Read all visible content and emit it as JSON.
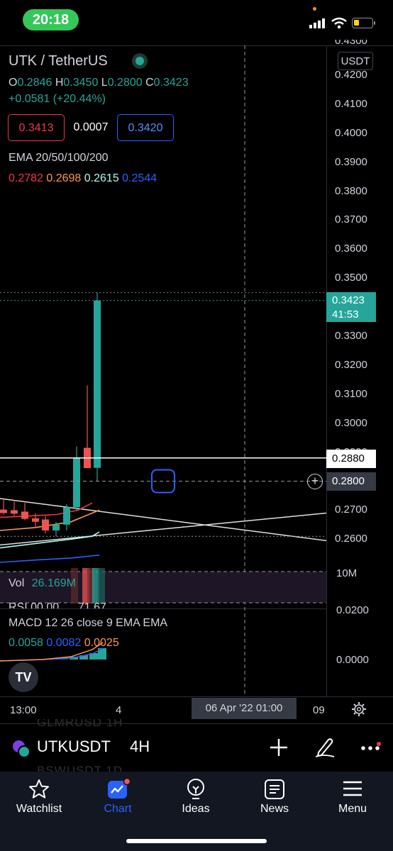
{
  "status_bar": {
    "time": "20:18"
  },
  "chart_header": {
    "pair": "UTK / TetherUS",
    "ohlc": {
      "o_label": "O",
      "o": "0.2846",
      "h_label": "H",
      "h": "0.3450",
      "l_label": "L",
      "l": "0.2800",
      "c_label": "C",
      "c": "0.3423"
    },
    "change": "+0.0581 (+20.44%)",
    "sell_price": "0.3413",
    "spread": "0.0007",
    "buy_price": "0.3420",
    "ema_label": "EMA 20/50/100/200",
    "ema_values": [
      {
        "value": "0.2782",
        "color": "#f23645"
      },
      {
        "value": "0.2698",
        "color": "#ff9850"
      },
      {
        "value": "0.2615",
        "color": "#aafcf0"
      },
      {
        "value": "0.2544",
        "color": "#2962ff"
      }
    ]
  },
  "price_axis": {
    "currency": "USDT",
    "ticks": [
      "0.4300",
      "0.4200",
      "0.4100",
      "0.4000",
      "0.3900",
      "0.3800",
      "0.3700",
      "0.3600",
      "0.3500",
      "0.3300",
      "0.3200",
      "0.3100",
      "0.3000",
      "0.2900",
      "0.2700",
      "0.2600"
    ],
    "last_price": "0.3423",
    "countdown": "41:53",
    "line_price": "0.2880",
    "crosshair_price": "0.2800"
  },
  "volume": {
    "label": "Vol",
    "value": "26.169M",
    "axis_tick": "10M",
    "rsi_partial": "RSI  00.00  ....  71.67"
  },
  "macd": {
    "label": "MACD 12 26 close 9 EMA EMA",
    "values": [
      {
        "value": "0.0058",
        "color": "#26a69a"
      },
      {
        "value": "0.0082",
        "color": "#2962ff"
      },
      {
        "value": "0.0025",
        "color": "#ff9850"
      }
    ],
    "axis_ticks": [
      "0.0200",
      "0.0000"
    ]
  },
  "time_axis": {
    "labels": [
      "13:00",
      "4",
      "09"
    ],
    "crosshair_time": "06 Apr '22   01:00"
  },
  "symbol_bar": {
    "symbol": "UTKUSDT",
    "interval": "4H",
    "ghost_above": "GLMRUSD   1H",
    "ghost_below": "BSWUSDT   1D"
  },
  "tabs": [
    {
      "label": "Watchlist",
      "icon": "star-icon"
    },
    {
      "label": "Chart",
      "icon": "chart-icon"
    },
    {
      "label": "Ideas",
      "icon": "lightbulb-icon"
    },
    {
      "label": "News",
      "icon": "news-icon"
    },
    {
      "label": "Menu",
      "icon": "menu-icon"
    }
  ],
  "chart_data": {
    "type": "candlestick",
    "title": "UTK / TetherUS",
    "interval": "4H",
    "candles": [
      {
        "o": 0.2702,
        "h": 0.2735,
        "l": 0.2685,
        "c": 0.269,
        "dir": "down"
      },
      {
        "o": 0.27,
        "h": 0.273,
        "l": 0.268,
        "c": 0.2688,
        "dir": "down"
      },
      {
        "o": 0.2695,
        "h": 0.2725,
        "l": 0.2665,
        "c": 0.267,
        "dir": "down"
      },
      {
        "o": 0.2672,
        "h": 0.269,
        "l": 0.264,
        "c": 0.266,
        "dir": "down"
      },
      {
        "o": 0.2668,
        "h": 0.268,
        "l": 0.262,
        "c": 0.263,
        "dir": "down"
      },
      {
        "o": 0.263,
        "h": 0.266,
        "l": 0.261,
        "c": 0.265,
        "dir": "up"
      },
      {
        "o": 0.265,
        "h": 0.272,
        "l": 0.263,
        "c": 0.271,
        "dir": "up"
      },
      {
        "o": 0.271,
        "h": 0.292,
        "l": 0.27,
        "c": 0.288,
        "dir": "up"
      },
      {
        "o": 0.2915,
        "h": 0.313,
        "l": 0.285,
        "c": 0.2845,
        "dir": "down"
      },
      {
        "o": 0.2846,
        "h": 0.345,
        "l": 0.28,
        "c": 0.3423,
        "dir": "up"
      }
    ],
    "colors": {
      "up": "#26a69a",
      "down": "#ef5350"
    },
    "ylim": [
      0.255,
      0.433
    ],
    "price_lines": [
      0.288,
      0.28
    ]
  }
}
